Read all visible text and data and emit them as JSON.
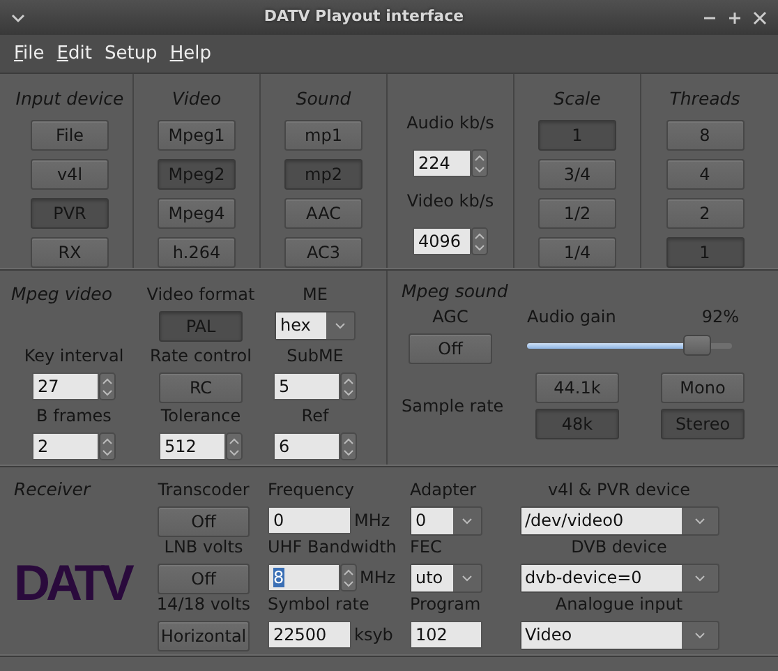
{
  "window": {
    "title": "DATV Playout interface"
  },
  "menu": [
    {
      "label": "File",
      "mnemonic": true
    },
    {
      "label": "Edit",
      "mnemonic": true
    },
    {
      "label": "Setup",
      "mnemonic": false
    },
    {
      "label": "Help",
      "mnemonic": true
    }
  ],
  "top_panel": [
    {
      "kind": "buttons",
      "title": "Input device",
      "buttons": [
        {
          "label": "File",
          "selected": false
        },
        {
          "label": "v4l",
          "selected": false
        },
        {
          "label": "PVR",
          "selected": true
        },
        {
          "label": "RX",
          "selected": false
        }
      ]
    },
    {
      "kind": "buttons",
      "title": "Video",
      "buttons": [
        {
          "label": "Mpeg1",
          "selected": false
        },
        {
          "label": "Mpeg2",
          "selected": true
        },
        {
          "label": "Mpeg4",
          "selected": false
        },
        {
          "label": "h.264",
          "selected": false
        }
      ]
    },
    {
      "kind": "buttons",
      "title": "Sound",
      "buttons": [
        {
          "label": "mp1",
          "selected": false
        },
        {
          "label": "mp2",
          "selected": true
        },
        {
          "label": "AAC",
          "selected": false
        },
        {
          "label": "AC3",
          "selected": false
        }
      ]
    },
    {
      "kind": "bitrates",
      "fields": [
        {
          "label": "Audio kb/s",
          "value": "224"
        },
        {
          "label": "Video kb/s",
          "value": "4096"
        }
      ]
    },
    {
      "kind": "buttons",
      "title": "Scale",
      "buttons": [
        {
          "label": "1",
          "selected": true
        },
        {
          "label": "3/4",
          "selected": false
        },
        {
          "label": "1/2",
          "selected": false
        },
        {
          "label": "1/4",
          "selected": false
        }
      ]
    },
    {
      "kind": "buttons",
      "title": "Threads",
      "buttons": [
        {
          "label": "8",
          "selected": false
        },
        {
          "label": "4",
          "selected": false
        },
        {
          "label": "2",
          "selected": false
        },
        {
          "label": "1",
          "selected": true
        }
      ]
    }
  ],
  "mpeg_video": {
    "title": "Mpeg video",
    "controls": [
      {
        "label": "Video format",
        "kind": "button",
        "value": "PAL",
        "selected": true
      },
      {
        "label": "ME",
        "kind": "combo",
        "value": "hex"
      },
      {
        "label": "Key interval",
        "kind": "spin",
        "value": "27"
      },
      {
        "label": "Rate control",
        "kind": "button",
        "value": "RC",
        "selected": false
      },
      {
        "label": "SubME",
        "kind": "spin",
        "value": "5"
      },
      {
        "label": "B frames",
        "kind": "spin",
        "value": "2"
      },
      {
        "label": "Tolerance",
        "kind": "spin",
        "value": "512"
      },
      {
        "label": "Ref",
        "kind": "spin",
        "value": "6"
      }
    ]
  },
  "mpeg_sound": {
    "title": "Mpeg sound",
    "agc": {
      "label": "AGC",
      "button": {
        "label": "Off",
        "selected": false
      }
    },
    "audio_gain": {
      "label": "Audio gain",
      "reading": "92%",
      "level": 0.83
    },
    "sample_rate": {
      "label": "Sample rate",
      "buttons": [
        {
          "label": "44.1k",
          "selected": false
        },
        {
          "label": "48k",
          "selected": true
        }
      ]
    },
    "channels": [
      {
        "label": "Mono",
        "selected": false
      },
      {
        "label": "Stereo",
        "selected": true
      }
    ]
  },
  "receiver": {
    "title": "Receiver",
    "logo": "DATV",
    "columns": [
      {
        "controls": [
          {
            "label": "Transcoder",
            "kind": "button",
            "value": "Off",
            "selected": false
          },
          {
            "label": "LNB volts",
            "kind": "button",
            "value": "Off",
            "selected": false
          },
          {
            "label": "14/18 volts",
            "kind": "button",
            "value": "Horizontal",
            "selected": false
          }
        ]
      },
      {
        "controls": [
          {
            "label": "Frequency",
            "kind": "text",
            "value": "0",
            "unit": "MHz"
          },
          {
            "label": "UHF Bandwidth",
            "kind": "spin",
            "value": "8",
            "unit": "MHz",
            "text_selected": true
          },
          {
            "label": "Symbol rate",
            "kind": "text",
            "value": "22500",
            "unit": "ksyb"
          }
        ]
      },
      {
        "controls": [
          {
            "label": "Adapter",
            "kind": "combo",
            "value": "0"
          },
          {
            "label": "FEC",
            "kind": "combo",
            "value": "uto"
          },
          {
            "label": "Program",
            "kind": "text",
            "value": "102"
          }
        ]
      },
      {
        "controls": [
          {
            "label": "v4l & PVR device",
            "kind": "combo",
            "value": "/dev/video0"
          },
          {
            "label": "DVB device",
            "kind": "combo",
            "value": "dvb-device=0"
          },
          {
            "label": "Analogue input",
            "kind": "combo",
            "value": "Video"
          }
        ]
      }
    ]
  }
}
